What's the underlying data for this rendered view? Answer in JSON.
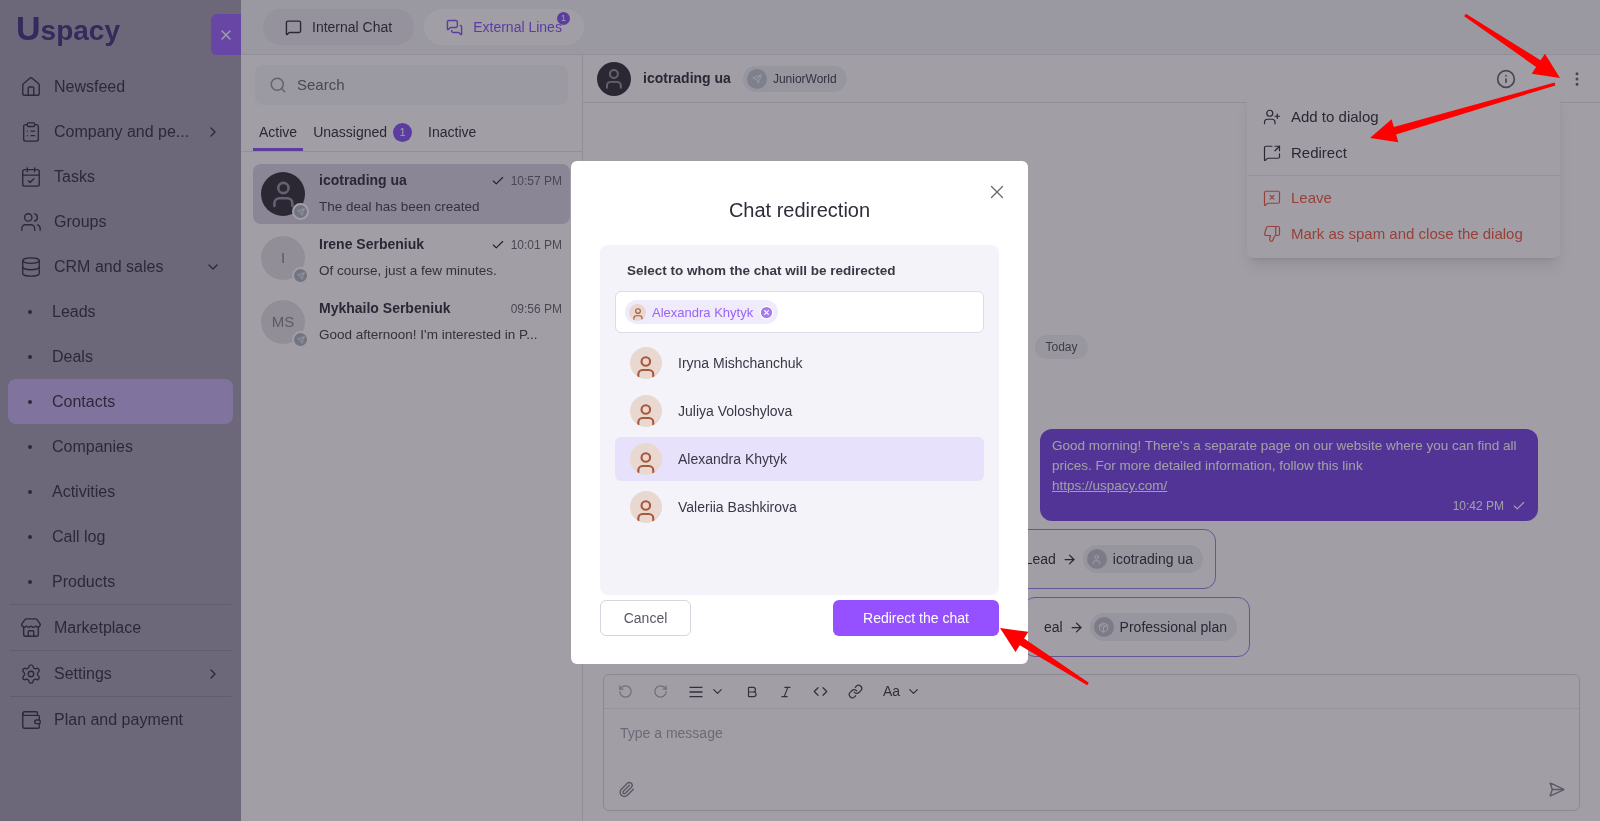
{
  "logo": {
    "mark": "U",
    "text": "spacy"
  },
  "sidebar": {
    "items": [
      {
        "kind": "main",
        "label": "Newsfeed",
        "selected": false
      },
      {
        "kind": "main",
        "label": "Company and pe...",
        "expanded": false,
        "selected": false
      },
      {
        "kind": "main",
        "label": "Tasks",
        "selected": false
      },
      {
        "kind": "main",
        "label": "Groups",
        "selected": false
      },
      {
        "kind": "main",
        "label": "CRM and sales",
        "expanded": true,
        "selected": false
      },
      {
        "kind": "sub",
        "label": "Leads",
        "selected": false
      },
      {
        "kind": "sub",
        "label": "Deals",
        "selected": false
      },
      {
        "kind": "sub",
        "label": "Contacts",
        "selected": true
      },
      {
        "kind": "sub",
        "label": "Companies",
        "selected": false
      },
      {
        "kind": "sub",
        "label": "Activities",
        "selected": false
      },
      {
        "kind": "sub",
        "label": "Call log",
        "selected": false
      },
      {
        "kind": "sub",
        "label": "Products",
        "selected": false
      },
      {
        "kind": "main",
        "label": "Marketplace",
        "selected": false
      },
      {
        "kind": "main",
        "label": "Settings",
        "expanded": false,
        "selected": false
      },
      {
        "kind": "main",
        "label": "Plan and payment",
        "selected": false
      }
    ]
  },
  "top_tabs": [
    {
      "label": "Internal Chat",
      "selected": false
    },
    {
      "label": "External Lines",
      "selected": true,
      "badge": "1"
    }
  ],
  "search": {
    "placeholder": "Search"
  },
  "list_tabs": [
    {
      "label": "Active",
      "selected": true
    },
    {
      "label": "Unassigned",
      "selected": false,
      "badge": "1"
    },
    {
      "label": "Inactive",
      "selected": false
    }
  ],
  "chats": [
    {
      "name": "icotrading ua",
      "time": "10:57 PM",
      "preview": "The deal has been created",
      "read": true,
      "kind": "photo",
      "selected": true
    },
    {
      "name": "Irene Serbeniuk",
      "time": "10:01 PM",
      "preview": "Of course, just a few minutes.",
      "read": true,
      "kind": "initials",
      "initials": "I",
      "selected": false
    },
    {
      "name": "Mykhailo Serbeniuk",
      "time": "09:56 PM",
      "preview": "Good afternoon! I'm interested in P...",
      "read": false,
      "kind": "initials",
      "initials": "MS",
      "selected": false
    }
  ],
  "chat_header": {
    "name": "icotrading ua",
    "channel": "JuniorWorld"
  },
  "menu": [
    {
      "label": "Add to dialog",
      "kind": "normal"
    },
    {
      "label": "Redirect",
      "kind": "normal"
    },
    {
      "label": "Leave",
      "kind": "danger"
    },
    {
      "label": "Mark as spam and close the dialog",
      "kind": "danger"
    }
  ],
  "messages": {
    "date": "Today",
    "bubble": {
      "text": "Good morning! There's a separate page on our website where you can find all prices. For more detailed information, follow this link",
      "link": "https://uspacy.com/",
      "time": "10:42 PM",
      "read": true
    },
    "events": [
      {
        "from": "Lead",
        "to": "icotrading ua"
      },
      {
        "from": "eal",
        "to": "Professional plan"
      }
    ]
  },
  "composer": {
    "font_label": "Aa",
    "placeholder": "Type a message"
  },
  "modal": {
    "title": "Chat redirection",
    "prompt": "Select to whom the chat will be redirected",
    "chip": "Alexandra Khytyk",
    "people": [
      {
        "name": "Iryna Mishchanchuk",
        "selected": false
      },
      {
        "name": "Juliya Voloshylova",
        "selected": false
      },
      {
        "name": "Alexandra Khytyk",
        "selected": true
      },
      {
        "name": "Valeriia Bashkirova",
        "selected": false
      }
    ],
    "cancel": "Cancel",
    "confirm": "Redirect the chat"
  }
}
